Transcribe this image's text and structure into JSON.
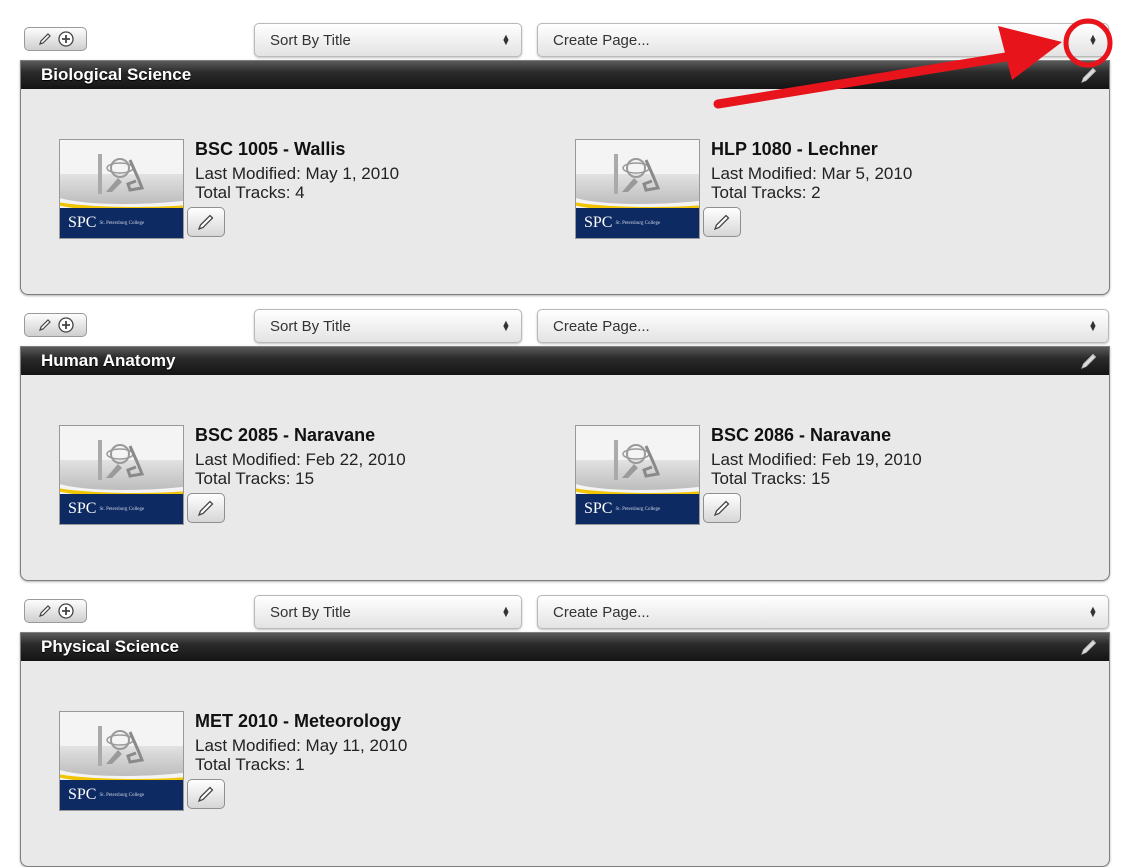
{
  "sort_label": "Sort By Title",
  "create_label": "Create Page...",
  "last_modified_prefix": "Last Modified: ",
  "total_tracks_prefix": "Total Tracks: ",
  "thumbnail_brand": "SPC",
  "thumbnail_subtitle": "St. Petersburg College",
  "annotation_color": "#e8141c",
  "sections": [
    {
      "title": "Biological Science",
      "items": [
        {
          "title": "BSC 1005 - Wallis",
          "last_modified": "Last Modified: May 1, 2010",
          "tracks": "Total Tracks: 4"
        },
        {
          "title": "HLP 1080 - Lechner",
          "last_modified": "Last Modified: Mar 5, 2010",
          "tracks": "Total Tracks: 2"
        }
      ]
    },
    {
      "title": "Human Anatomy",
      "items": [
        {
          "title": "BSC 2085 - Naravane",
          "last_modified": "Last Modified: Feb 22, 2010",
          "tracks": "Total Tracks: 15"
        },
        {
          "title": "BSC 2086 - Naravane",
          "last_modified": "Last Modified: Feb 19, 2010",
          "tracks": "Total Tracks: 15"
        }
      ]
    },
    {
      "title": "Physical Science",
      "items": [
        {
          "title": "MET 2010 - Meteorology",
          "last_modified": "Last Modified: May 11, 2010",
          "tracks": "Total Tracks: 1"
        }
      ]
    }
  ]
}
